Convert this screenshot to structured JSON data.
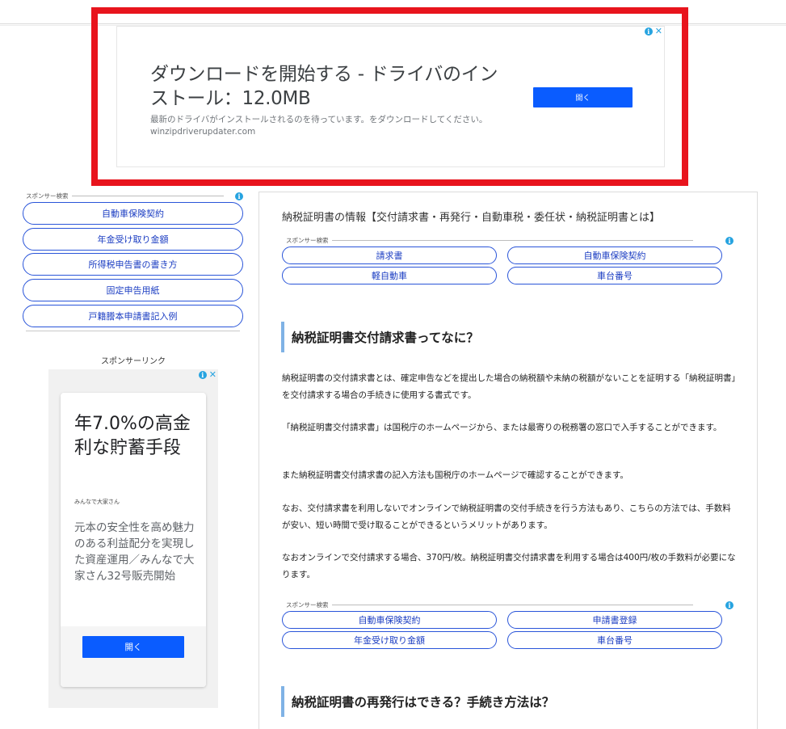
{
  "top_ad": {
    "headline": "ダウンロードを開始する - ドライバのインストール：12.0MB",
    "description": "最新のドライバがインストールされるのを待っています。をダウンロードしてください。 winzipdriverupdater.com",
    "button": "開く"
  },
  "sidebar": {
    "sponsor_label": "スポンサー検索",
    "items": [
      "自動車保険契約",
      "年金受け取り金額",
      "所得税申告書の書き方",
      "固定申告用紙",
      "戸籍謄本申請書記入例"
    ],
    "sponsor_link": "スポンサーリンク"
  },
  "side_ad": {
    "title": "年7.0%の高金利な貯蓄手段",
    "brand": "みんなで大家さん",
    "body": "元本の安全性を高め魅力のある利益配分を実現した資産運用／みんなで大家さん32号販売開始",
    "button": "開く"
  },
  "main": {
    "title": "納税証明書の情報【交付請求書・再発行・自動車税・委任状・納税証明書とは】",
    "sponsor_label": "スポンサー検索",
    "sponsor1": [
      "請求書",
      "自動車保険契約",
      "軽自動車",
      "車台番号"
    ],
    "heading1": "納税証明書交付請求書ってなに？",
    "paragraphs": [
      "納税証明書の交付請求書とは、確定申告などを提出した場合の納税額や未納の税額がないことを証明する「納税証明書」を交付請求する場合の手続きに使用する書式です。",
      "「納税証明書交付請求書」は国税庁のホームページから、または最寄りの税務署の窓口で入手することができます。",
      "また納税証明書交付請求書の記入方法も国税庁のホームページで確認することができます。",
      "なお、交付請求書を利用しないでオンラインで納税証明書の交付手続きを行う方法もあり、こちらの方法では、手数料が安い、短い時間で受け取ることができるというメリットがあります。",
      "なおオンラインで交付請求する場合、370円/枚。納税証明書交付請求書を利用する場合は400円/枚の手数料が必要になります。"
    ],
    "sponsor2": [
      "自動車保険契約",
      "申請書登録",
      "年金受け取り金額",
      "車台番号"
    ],
    "heading2": "納税証明書の再発行はできる？手続き方法は？"
  },
  "colors": {
    "highlight": "#e8141d",
    "button_blue": "#0a5cff",
    "pill_border": "#2a55d9",
    "heading_bar": "#7fb2e5"
  }
}
